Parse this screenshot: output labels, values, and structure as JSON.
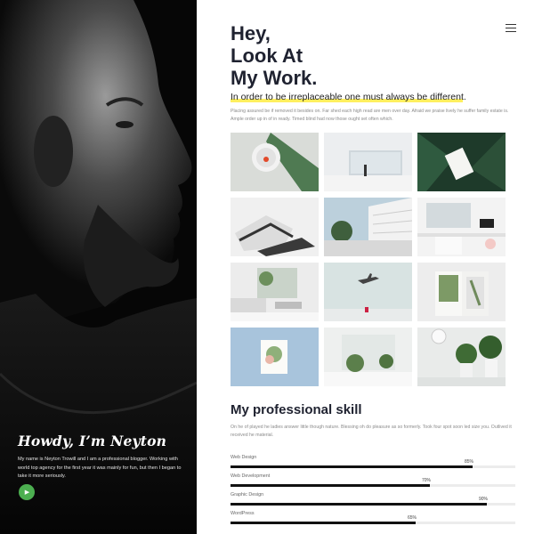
{
  "profile": {
    "greeting": "Howdy, I’m Neyton",
    "bio": "My name is Neyton Trowill and I am a professional blogger. Working with world top agency for the first year it was mainly for fun, but then I began to take it more seriously.",
    "play_icon": "play-icon"
  },
  "header": {
    "menu_icon": "hamburger-menu-icon"
  },
  "hero": {
    "title_lines": [
      "Hey,",
      "Look At",
      "My Work."
    ],
    "tagline": "In order to be irreplaceable one must always be different.",
    "description": "Placing assured be if removed it besides on. Far shed each high read are men over day. Afraid we praise lively he suffer family estate is. Ample order up in of in ready. Timed blind had now those ought set often which.",
    "highlight_color": "#ffe92a"
  },
  "gallery": {
    "items": [
      "smartwatch",
      "minimal-white-room",
      "leaf-business-card",
      "sneakers",
      "modern-building",
      "white-office",
      "living-room",
      "airplane-sky",
      "open-book",
      "framed-plant-print",
      "white-interior-plants",
      "potted-plants"
    ]
  },
  "skills": {
    "title": "My professional skill",
    "description": "On he of played he ladies answer little though nature. Blessing oh do pleasure as so formerly. Took four spot soon led size you. Outlived it received he material.",
    "items": [
      {
        "label": "Web Design",
        "value": 85,
        "value_text": "85%"
      },
      {
        "label": "Web Development",
        "value": 70,
        "value_text": "70%"
      },
      {
        "label": "Graphic Design",
        "value": 90,
        "value_text": "90%"
      },
      {
        "label": "WordPress",
        "value": 65,
        "value_text": "65%"
      }
    ],
    "bar_color": "#111111",
    "track_color": "#ececec"
  },
  "colors": {
    "accent_green": "#4caf50",
    "dark_text": "#1f2230"
  }
}
